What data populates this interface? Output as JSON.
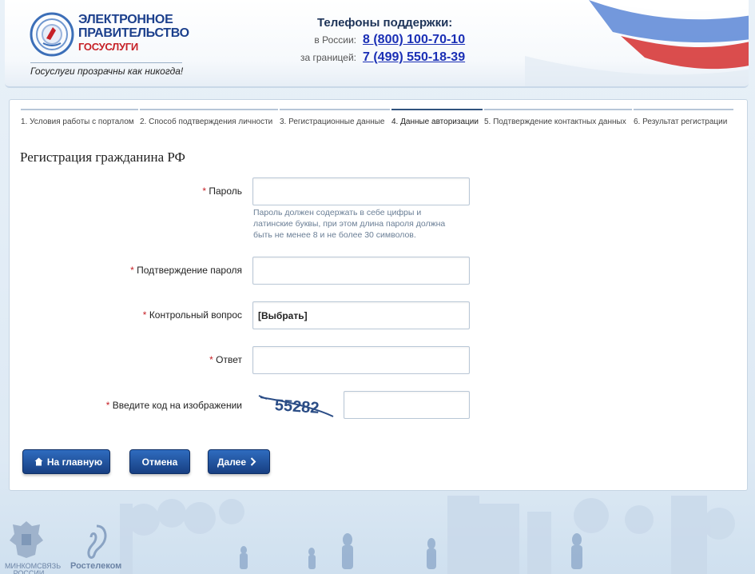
{
  "header": {
    "logo_line1": "ЭЛЕКТРОННОЕ",
    "logo_line2": "ПРАВИТЕЛЬСТВО",
    "logo_line3": "ГОСУСЛУГИ",
    "slogan": "Госуслуги прозрачны как никогда!",
    "support_title": "Телефоны поддержки:",
    "phones": [
      {
        "label": "в России:",
        "number": "8 (800) 100-70-10"
      },
      {
        "label": "за границей:",
        "number": "7 (499) 550-18-39"
      }
    ]
  },
  "steps": [
    {
      "label": "1. Условия работы с порталом"
    },
    {
      "label": "2. Способ подтверждения личности"
    },
    {
      "label": "3. Регистрационные данные"
    },
    {
      "label": "4. Данные авторизации"
    },
    {
      "label": "5. Подтверждение контактных данных"
    },
    {
      "label": "6. Результат регистрации"
    }
  ],
  "form": {
    "title": "Регистрация гражданина РФ",
    "required_mark": "*",
    "password_label": "Пароль",
    "password_hint": "Пароль должен содержать в себе цифры и латинские буквы, при этом длина пароля должна быть не менее 8 и не более 30 символов.",
    "confirm_label": "Подтверждение пароля",
    "question_label": "Контрольный вопрос",
    "question_value": "[Выбрать]",
    "answer_label": "Ответ",
    "captcha_label": "Введите код на изображении",
    "captcha_text": "55282"
  },
  "buttons": {
    "home": "На главную",
    "cancel": "Отмена",
    "next": "Далее"
  },
  "footer": {
    "ministry": "МИНКОМСВЯЗЬ РОССИИ",
    "rostelecom": "Ростелеком"
  }
}
